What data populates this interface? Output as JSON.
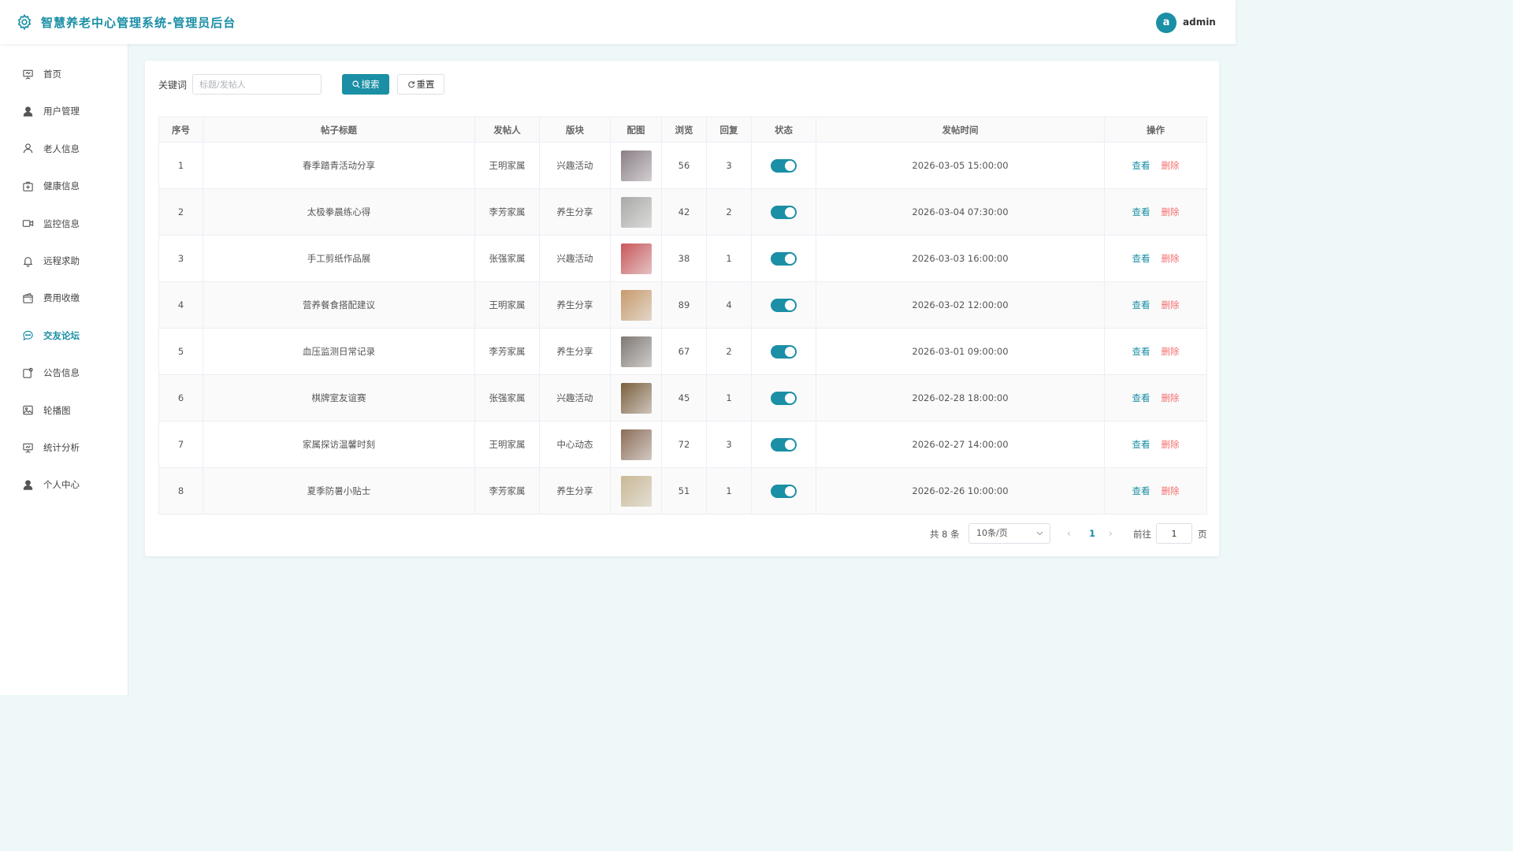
{
  "header": {
    "title": "智慧养老中心管理系统-管理员后台",
    "avatar_letter": "a",
    "username": "admin",
    "accent_color": "#1a8fa5"
  },
  "sidebar": {
    "items": [
      {
        "label": "首页",
        "icon": "presentation-icon"
      },
      {
        "label": "用户管理",
        "icon": "user-filled-icon"
      },
      {
        "label": "老人信息",
        "icon": "user-icon"
      },
      {
        "label": "健康信息",
        "icon": "first-aid-kit-icon"
      },
      {
        "label": "监控信息",
        "icon": "video-camera-icon"
      },
      {
        "label": "远程求助",
        "icon": "bell-icon"
      },
      {
        "label": "费用收缴",
        "icon": "wallet-icon"
      },
      {
        "label": "交友论坛",
        "icon": "chat-bubble-icon",
        "active": true
      },
      {
        "label": "公告信息",
        "icon": "notification-icon"
      },
      {
        "label": "轮播图",
        "icon": "picture-icon"
      },
      {
        "label": "统计分析",
        "icon": "chart-board-icon"
      },
      {
        "label": "个人中心",
        "icon": "user-filled-icon"
      }
    ]
  },
  "search": {
    "label": "关键词",
    "placeholder": "标题/发帖人",
    "search_button": "搜索",
    "reset_button": "重置"
  },
  "table": {
    "columns": [
      "序号",
      "帖子标题",
      "发帖人",
      "版块",
      "配图",
      "浏览",
      "回复",
      "状态",
      "发帖时间",
      "操作"
    ],
    "rows": [
      {
        "no": "1",
        "title": "春季踏青活动分享",
        "author": "王明家属",
        "board": "兴趣活动",
        "views": "56",
        "replies": "3",
        "enabled": true,
        "time": "2026-03-05 15:00:00",
        "thumb_color": "#8a7f86"
      },
      {
        "no": "2",
        "title": "太极拳晨练心得",
        "author": "李芳家属",
        "board": "养生分享",
        "views": "42",
        "replies": "2",
        "enabled": true,
        "time": "2026-03-04 07:30:00",
        "thumb_color": "#a9a9a7"
      },
      {
        "no": "3",
        "title": "手工剪纸作品展",
        "author": "张强家属",
        "board": "兴趣活动",
        "views": "38",
        "replies": "1",
        "enabled": true,
        "time": "2026-03-03 16:00:00",
        "thumb_color": "#c9565a"
      },
      {
        "no": "4",
        "title": "营养餐食搭配建议",
        "author": "王明家属",
        "board": "养生分享",
        "views": "89",
        "replies": "4",
        "enabled": true,
        "time": "2026-03-02 12:00:00",
        "thumb_color": "#c79a6b"
      },
      {
        "no": "5",
        "title": "血压监测日常记录",
        "author": "李芳家属",
        "board": "养生分享",
        "views": "67",
        "replies": "2",
        "enabled": true,
        "time": "2026-03-01 09:00:00",
        "thumb_color": "#7e7873"
      },
      {
        "no": "6",
        "title": "棋牌室友谊赛",
        "author": "张强家属",
        "board": "兴趣活动",
        "views": "45",
        "replies": "1",
        "enabled": true,
        "time": "2026-02-28 18:00:00",
        "thumb_color": "#7a5f3d"
      },
      {
        "no": "7",
        "title": "家属探访温馨时刻",
        "author": "王明家属",
        "board": "中心动态",
        "views": "72",
        "replies": "3",
        "enabled": true,
        "time": "2026-02-27 14:00:00",
        "thumb_color": "#8c6d58"
      },
      {
        "no": "8",
        "title": "夏季防暑小贴士",
        "author": "李芳家属",
        "board": "养生分享",
        "views": "51",
        "replies": "1",
        "enabled": true,
        "time": "2026-02-26 10:00:00",
        "thumb_color": "#c9b894"
      }
    ],
    "view_label": "查看",
    "delete_label": "删除"
  },
  "pagination": {
    "total": "共 8 条",
    "page_size": "10条/页",
    "current_page": "1",
    "goto_label": "前往",
    "goto_value": "1",
    "goto_suffix": "页"
  }
}
